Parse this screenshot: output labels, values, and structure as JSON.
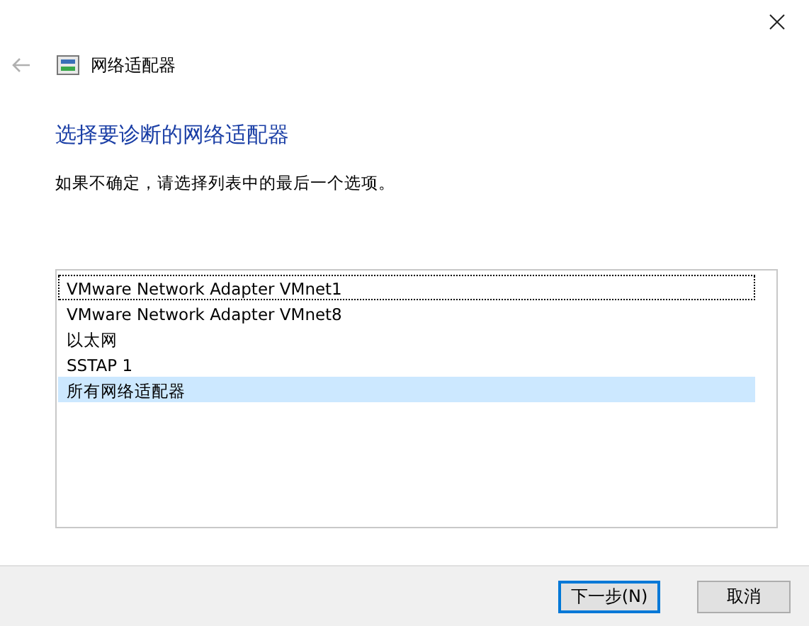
{
  "window": {
    "title": "网络适配器"
  },
  "heading": "选择要诊断的网络适配器",
  "instruction": "如果不确定，请选择列表中的最后一个选项。",
  "adapters": [
    {
      "label": "VMware Network Adapter VMnet1",
      "selected": false,
      "focused": true
    },
    {
      "label": "VMware Network Adapter VMnet8",
      "selected": false,
      "focused": false
    },
    {
      "label": "以太网",
      "selected": false,
      "focused": false
    },
    {
      "label": "SSTAP 1",
      "selected": false,
      "focused": false
    },
    {
      "label": "所有网络适配器",
      "selected": true,
      "focused": false
    }
  ],
  "buttons": [
    {
      "label": "下一步(N)",
      "kind": "default"
    },
    {
      "label": "取消",
      "kind": "normal"
    }
  ]
}
